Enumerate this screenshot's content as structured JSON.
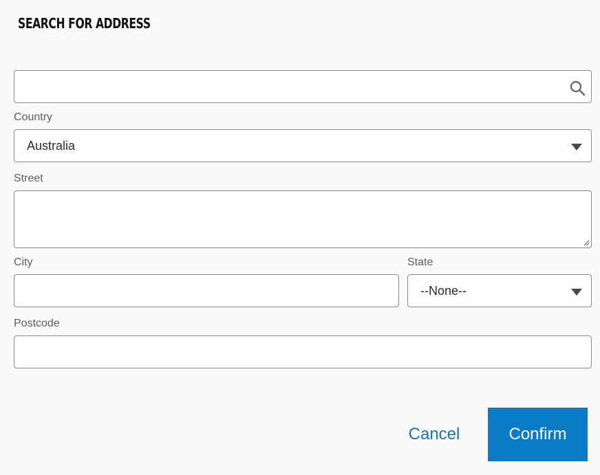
{
  "dialog": {
    "title": "SEARCH FOR ADDRESS"
  },
  "search": {
    "value": "",
    "placeholder": "",
    "icon": "search-icon"
  },
  "country": {
    "label": "Country",
    "selected": "Australia"
  },
  "street": {
    "label": "Street",
    "value": ""
  },
  "city": {
    "label": "City",
    "value": ""
  },
  "state": {
    "label": "State",
    "selected": "--None--"
  },
  "postcode": {
    "label": "Postcode",
    "value": ""
  },
  "actions": {
    "cancel_label": "Cancel",
    "confirm_label": "Confirm"
  },
  "colors": {
    "accent": "#0a7bc7",
    "link": "#1874b8",
    "background": "#fafafa",
    "border": "#8a8a8a"
  }
}
